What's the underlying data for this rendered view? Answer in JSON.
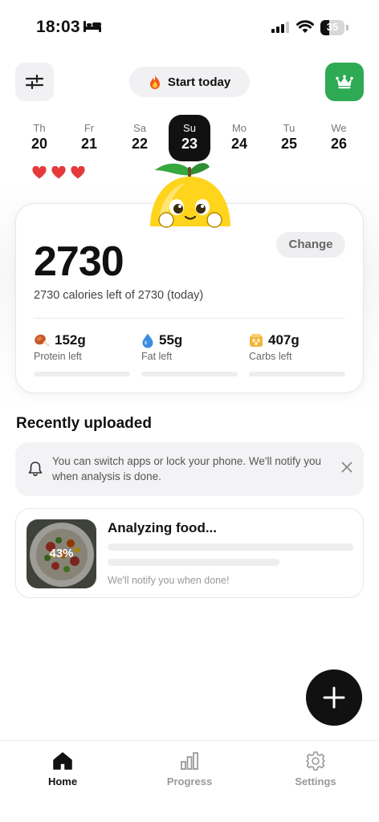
{
  "status_bar": {
    "time": "18:03",
    "battery": "35"
  },
  "header": {
    "start_label": "Start today"
  },
  "week": [
    {
      "name": "Th",
      "date": "20"
    },
    {
      "name": "Fr",
      "date": "21"
    },
    {
      "name": "Sa",
      "date": "22"
    },
    {
      "name": "Su",
      "date": "23",
      "active": true
    },
    {
      "name": "Mo",
      "date": "24"
    },
    {
      "name": "Tu",
      "date": "25"
    },
    {
      "name": "We",
      "date": "26"
    }
  ],
  "hearts_count": 3,
  "calories": {
    "value": "2730",
    "change_label": "Change",
    "subtitle": "2730 calories left of 2730 (today)",
    "macros": [
      {
        "value": "152g",
        "label": "Protein left",
        "icon": "drumstick-icon",
        "progress": 0
      },
      {
        "value": "55g",
        "label": "Fat left",
        "icon": "drop-icon",
        "progress": 0
      },
      {
        "value": "407g",
        "label": "Carbs left",
        "icon": "grain-icon",
        "progress": 0
      }
    ]
  },
  "recent": {
    "title": "Recently uploaded",
    "notice": "You can switch apps or lock your phone. We'll notify you when analysis is done.",
    "item": {
      "title": "Analyzing food...",
      "progress": "43%",
      "subtitle": "We'll notify you when done!"
    }
  },
  "tabs": [
    {
      "label": "Home",
      "active": true
    },
    {
      "label": "Progress"
    },
    {
      "label": "Settings"
    }
  ],
  "colors": {
    "accent": "#2eaa55",
    "dark": "#111111",
    "heart": "#e5393b"
  }
}
